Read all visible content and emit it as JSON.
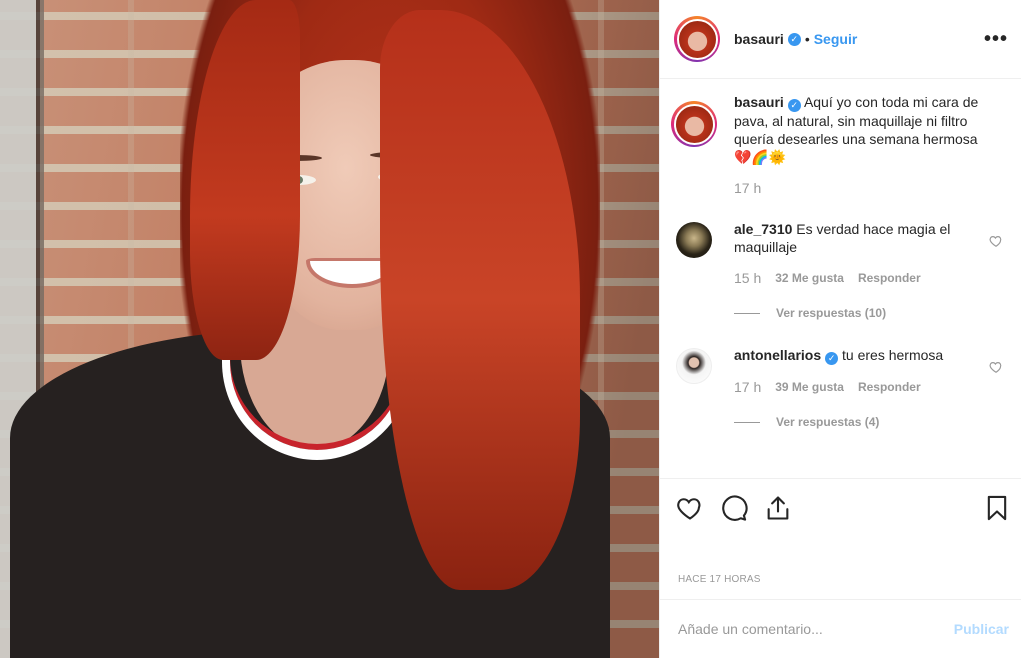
{
  "header": {
    "username": "basauri",
    "separator": "•",
    "follow_label": "Seguir",
    "more_label": "•••"
  },
  "caption": {
    "username": "basauri",
    "text": "Aquí yo con toda mi cara de pava, al natural, sin maquillaje ni filtro quería desearles una semana hermosa💔🌈🌞",
    "time": "17 h"
  },
  "comments": [
    {
      "username": "ale_7310",
      "verified": false,
      "text": "Es verdad hace magia el maquillaje",
      "time": "15 h",
      "likes": "32 Me gusta",
      "reply_label": "Responder",
      "view_replies": "Ver respuestas (10)"
    },
    {
      "username": "antonellarios",
      "verified": true,
      "text": "tu eres hermosa",
      "time": "17 h",
      "likes": "39 Me gusta",
      "reply_label": "Responder",
      "view_replies": "Ver respuestas (4)"
    }
  ],
  "actions": {
    "like_icon": "heart-icon",
    "comment_icon": "comment-bubble-icon",
    "share_icon": "share-upload-icon",
    "save_icon": "bookmark-icon"
  },
  "timestamp": "HACE 17 HORAS",
  "add_comment": {
    "placeholder": "Añade un comentario...",
    "publish_label": "Publicar"
  },
  "colors": {
    "accent": "#3897f0",
    "publish_disabled": "#b3dbff",
    "muted": "#999999",
    "text": "#262626"
  }
}
